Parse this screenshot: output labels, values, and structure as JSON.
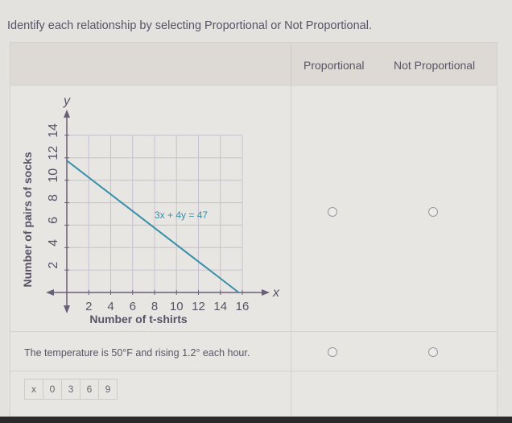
{
  "instruction": "Identify each relationship by selecting Proportional or Not Proportional.",
  "table": {
    "headers": [
      "Proportional",
      "Not Proportional"
    ],
    "rows": [
      {
        "type": "graph",
        "selected": null
      },
      {
        "type": "text",
        "text": "The temperature is 50°F and rising 1.2° each hour.",
        "selected": null
      },
      {
        "type": "table",
        "cells": [
          "x",
          "0",
          "3",
          "6",
          "9"
        ],
        "selected": null
      }
    ]
  },
  "chart_data": {
    "type": "line",
    "title": "",
    "xlabel": "Number of t-shirts",
    "ylabel": "Number of pairs of socks",
    "x_axis_symbol": "x",
    "y_axis_symbol": "y",
    "xlim": [
      0,
      16
    ],
    "ylim": [
      0,
      14
    ],
    "x_ticks": [
      "2",
      "4",
      "6",
      "8",
      "10",
      "12",
      "14",
      "16"
    ],
    "y_ticks": [
      "2",
      "4",
      "6",
      "8",
      "10",
      "12",
      "14"
    ],
    "grid": true,
    "series": [
      {
        "name": "3x + 4y = 47",
        "color": "#3a8fa8",
        "points": [
          [
            0,
            11.75
          ],
          [
            15.67,
            0
          ]
        ]
      }
    ],
    "annotation": "3x + 4y = 47"
  }
}
